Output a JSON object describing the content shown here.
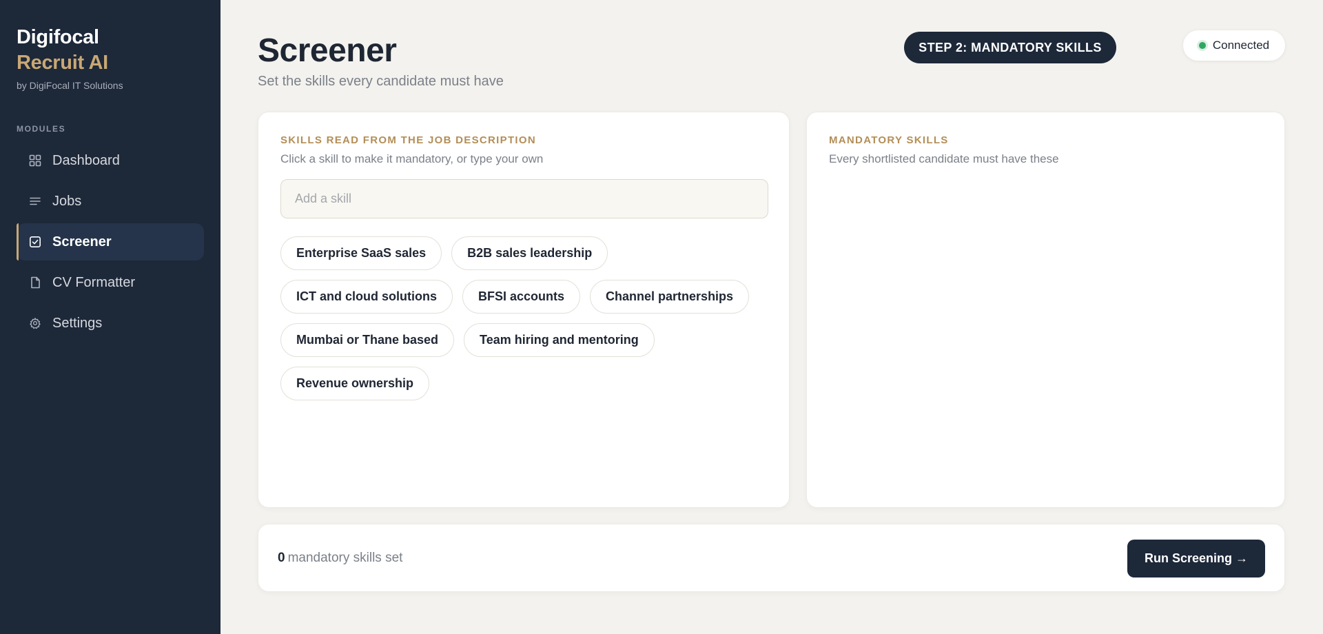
{
  "brand": {
    "line1": "Digifocal",
    "line2": "Recruit AI",
    "byline": "by DigiFocal IT Solutions"
  },
  "sidebar": {
    "section_label": "MODULES",
    "items": [
      {
        "label": "Dashboard",
        "icon": "grid-icon",
        "active": false
      },
      {
        "label": "Jobs",
        "icon": "list-icon",
        "active": false
      },
      {
        "label": "Screener",
        "icon": "check-square-icon",
        "active": true
      },
      {
        "label": "CV Formatter",
        "icon": "file-icon",
        "active": false
      },
      {
        "label": "Settings",
        "icon": "gear-icon",
        "active": false
      }
    ]
  },
  "header": {
    "title": "Screener",
    "subtitle": "Set the skills every candidate must have",
    "step": "STEP 2: MANDATORY SKILLS",
    "status": "Connected"
  },
  "skills_panel": {
    "label": "SKILLS READ FROM THE JOB DESCRIPTION",
    "hint": "Click a skill to make it mandatory, or type your own",
    "input_placeholder": "Add a skill",
    "input_value": "",
    "chips": [
      "Enterprise SaaS sales",
      "B2B sales leadership",
      "ICT and cloud solutions",
      "BFSI accounts",
      "Channel partnerships",
      "Mumbai or Thane based",
      "Team hiring and mentoring",
      "Revenue ownership"
    ]
  },
  "mandatory_panel": {
    "label": "MANDATORY SKILLS",
    "hint": "Every shortlisted candidate must have these"
  },
  "footer": {
    "count": "0",
    "count_suffix": "mandatory skills set",
    "run_button": "Run Screening →"
  },
  "colors": {
    "sidebar_bg": "#1d2839",
    "accent_gold": "#c9a774",
    "page_bg": "#f3f2ee",
    "status_green": "#2fa764"
  }
}
